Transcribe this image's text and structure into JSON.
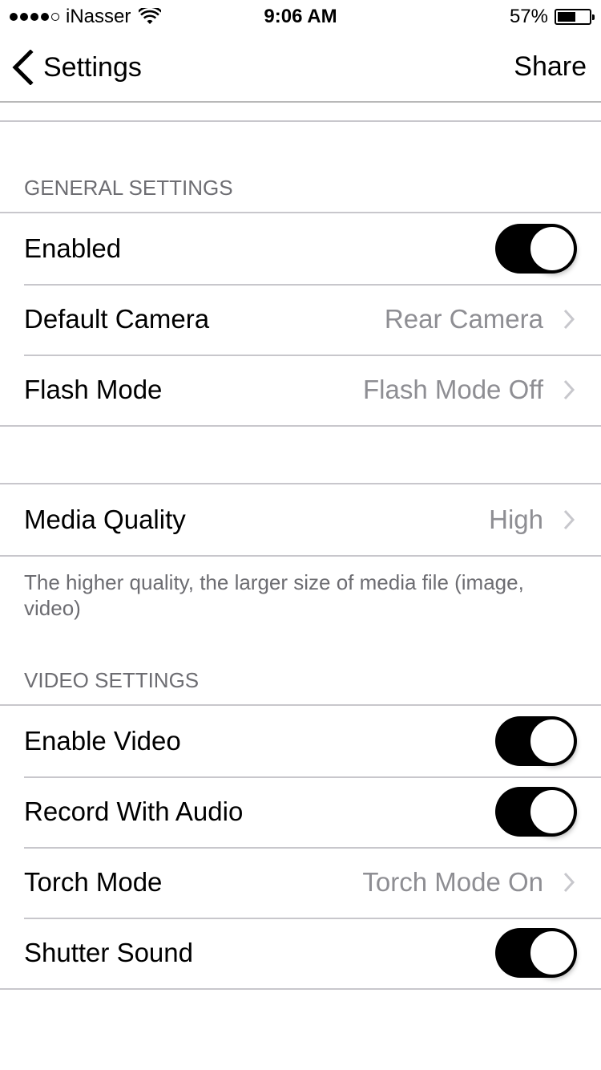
{
  "status_bar": {
    "signal_bars_filled": 4,
    "signal_bars_total": 5,
    "carrier": "iNasser",
    "time": "9:06 AM",
    "battery_percent_label": "57%",
    "battery_level": 0.57
  },
  "nav": {
    "back_label": "Settings",
    "share_label": "Share"
  },
  "sections": {
    "general": {
      "header": "GENERAL SETTINGS",
      "rows": [
        {
          "label": "Enabled",
          "type": "toggle",
          "on": true
        },
        {
          "label": "Default Camera",
          "type": "disclosure",
          "value": "Rear Camera"
        },
        {
          "label": "Flash Mode",
          "type": "disclosure",
          "value": "Flash Mode Off"
        }
      ]
    },
    "quality": {
      "rows": [
        {
          "label": "Media Quality",
          "type": "disclosure",
          "value": "High"
        }
      ],
      "footer": "The higher quality, the larger size of media file (image, video)"
    },
    "video": {
      "header": "VIDEO SETTINGS",
      "rows": [
        {
          "label": "Enable Video",
          "type": "toggle",
          "on": true
        },
        {
          "label": "Record With Audio",
          "type": "toggle",
          "on": true
        },
        {
          "label": "Torch Mode",
          "type": "disclosure",
          "value": "Torch Mode On"
        },
        {
          "label": "Shutter Sound",
          "type": "toggle",
          "on": true
        }
      ]
    }
  },
  "colors": {
    "toggle_on": "#000000",
    "secondary_text": "#8e8e93",
    "header_text": "#6d6d72",
    "separator": "#c8c7cc"
  }
}
